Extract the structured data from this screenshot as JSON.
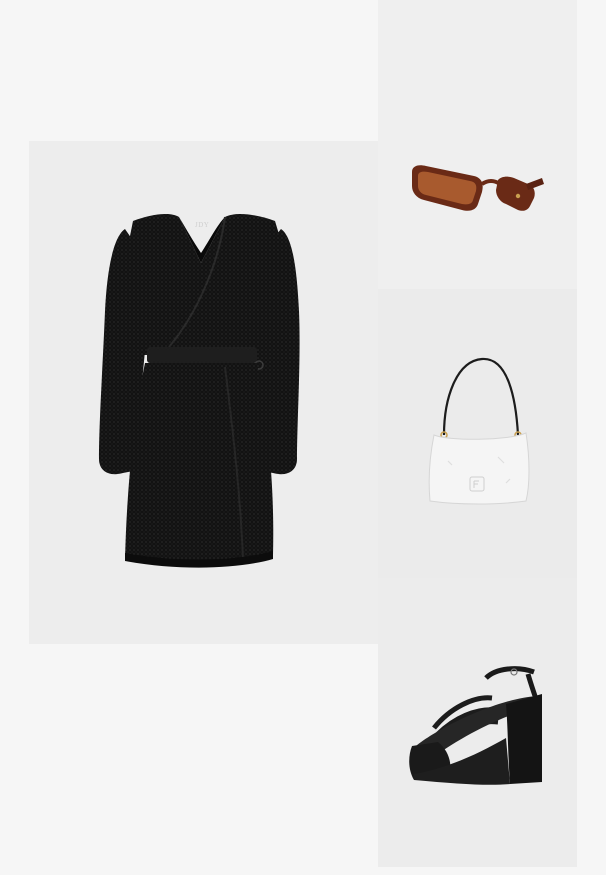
{
  "outfit": {
    "items": [
      {
        "kind": "dress",
        "icon": "dress-icon",
        "label_text": "JDY"
      },
      {
        "kind": "sunglasses",
        "icon": "sunglasses-icon"
      },
      {
        "kind": "shoulder-bag",
        "icon": "handbag-icon"
      },
      {
        "kind": "platform-sandals",
        "icon": "sandal-icon"
      }
    ]
  },
  "colors": {
    "page_bg": "#f6f6f6",
    "dress": "#141414",
    "lens": "#a85a2e",
    "frame": "#6a2a16",
    "bag": "#f3f3f3",
    "shoe": "#1a1a1a"
  }
}
